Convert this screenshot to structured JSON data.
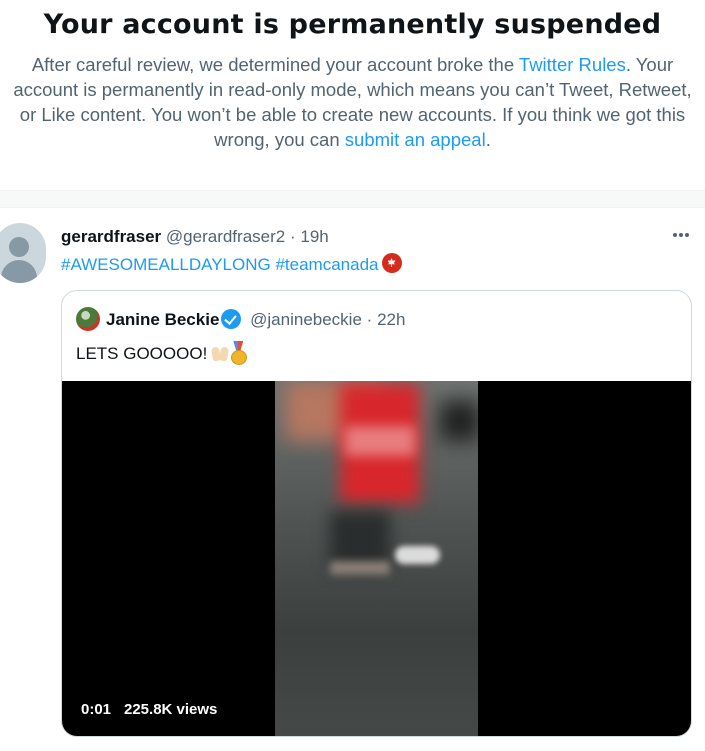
{
  "banner": {
    "title": "Your account is permanently suspended",
    "text_1": "After careful review, we determined your account broke the ",
    "rules_link": "Twitter Rules",
    "text_2": ". Your account is permanently in read-only mode, which means you can’t Tweet, Retweet, or Like content. You won’t be able to create new accounts. If you think we got this wrong, you can ",
    "appeal_link": "submit an appeal",
    "text_3": "."
  },
  "tweet": {
    "display_name": "gerardfraser",
    "handle": "@gerardfraser2",
    "separator": "·",
    "time": "19h",
    "hashtags": [
      "#AWESOMEALLDAYLONG",
      "#teamcanada"
    ],
    "more_icon": "more-horizontal-icon",
    "avatar_icon": "default-profile-icon",
    "flag_icon": "canada-flag-emoji"
  },
  "quote": {
    "display_name": "Janine Beckie",
    "verified_icon": "verified-badge-icon",
    "handle": "@janinebeckie",
    "separator": "·",
    "time": "22h",
    "text": "LETS GOOOOO!",
    "emojis": [
      "raising-hands-emoji",
      "gold-medal-emoji"
    ],
    "video": {
      "current_time": "0:01",
      "views": "225.8K views"
    }
  },
  "colors": {
    "link": "#1d9bf0",
    "secondary_text": "#536471",
    "primary_text": "#0f1419",
    "verified": "#1d9bf0"
  }
}
